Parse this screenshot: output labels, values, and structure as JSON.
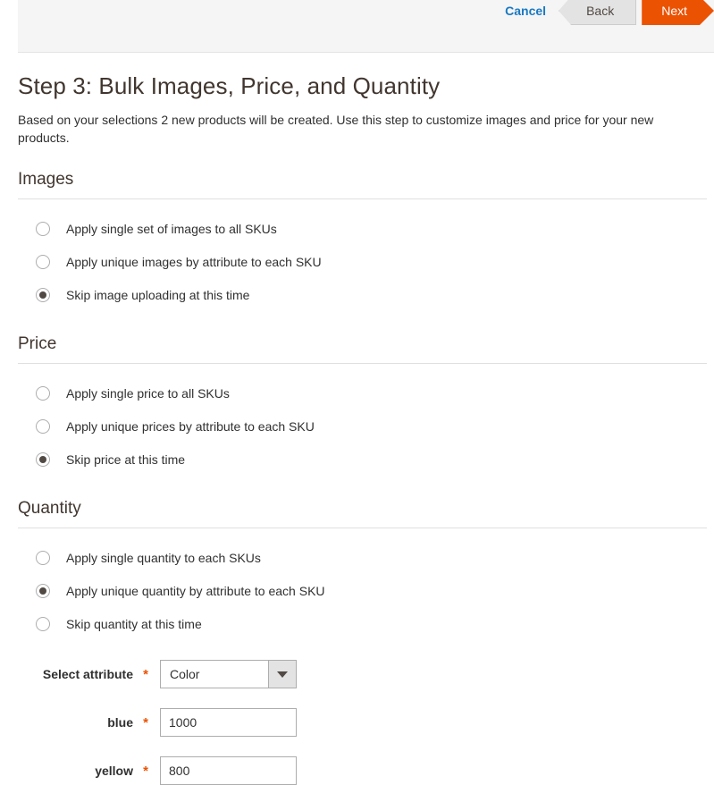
{
  "header": {
    "cancel_label": "Cancel",
    "back_label": "Back",
    "next_label": "Next",
    "accent_orange": "#eb5202",
    "link_blue": "#1979c3"
  },
  "page": {
    "title": "Step 3: Bulk Images, Price, and Quantity",
    "description": "Based on your selections 2 new products will be created. Use this step to customize images and price for your new products."
  },
  "sections": [
    {
      "title": "Images",
      "options": [
        {
          "label": "Apply single set of images to all SKUs",
          "selected": false
        },
        {
          "label": "Apply unique images by attribute to each SKU",
          "selected": false
        },
        {
          "label": "Skip image uploading at this time",
          "selected": true
        }
      ]
    },
    {
      "title": "Price",
      "options": [
        {
          "label": "Apply single price to all SKUs",
          "selected": false
        },
        {
          "label": "Apply unique prices by attribute to each SKU",
          "selected": false
        },
        {
          "label": "Skip price at this time",
          "selected": true
        }
      ]
    },
    {
      "title": "Quantity",
      "options": [
        {
          "label": "Apply single quantity to each SKUs",
          "selected": false
        },
        {
          "label": "Apply unique quantity by attribute to each SKU",
          "selected": true
        },
        {
          "label": "Skip quantity at this time",
          "selected": false
        }
      ]
    }
  ],
  "quantity_form": {
    "attribute_field": {
      "label": "Select attribute",
      "required_marker": "*",
      "selected_value": "Color"
    },
    "value_fields": [
      {
        "label": "blue",
        "required_marker": "*",
        "value": "1000"
      },
      {
        "label": "yellow",
        "required_marker": "*",
        "value": "800"
      }
    ]
  }
}
